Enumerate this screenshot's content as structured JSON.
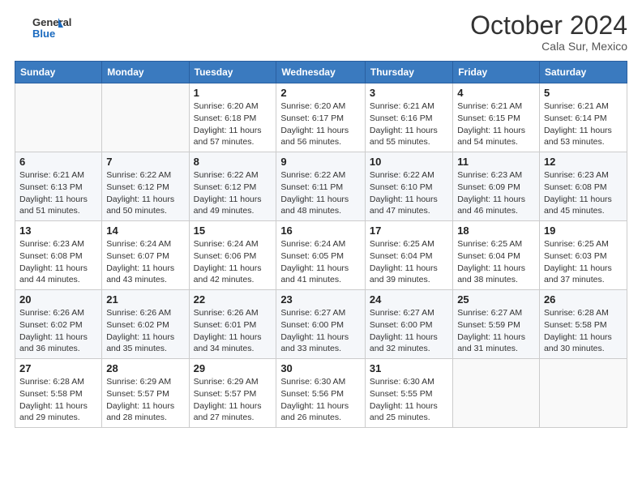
{
  "header": {
    "logo_text_general": "General",
    "logo_text_blue": "Blue",
    "month": "October 2024",
    "location": "Cala Sur, Mexico"
  },
  "weekdays": [
    "Sunday",
    "Monday",
    "Tuesday",
    "Wednesday",
    "Thursday",
    "Friday",
    "Saturday"
  ],
  "weeks": [
    [
      {
        "day": "",
        "sunrise": "",
        "sunset": "",
        "daylight": ""
      },
      {
        "day": "",
        "sunrise": "",
        "sunset": "",
        "daylight": ""
      },
      {
        "day": "1",
        "sunrise": "Sunrise: 6:20 AM",
        "sunset": "Sunset: 6:18 PM",
        "daylight": "Daylight: 11 hours and 57 minutes."
      },
      {
        "day": "2",
        "sunrise": "Sunrise: 6:20 AM",
        "sunset": "Sunset: 6:17 PM",
        "daylight": "Daylight: 11 hours and 56 minutes."
      },
      {
        "day": "3",
        "sunrise": "Sunrise: 6:21 AM",
        "sunset": "Sunset: 6:16 PM",
        "daylight": "Daylight: 11 hours and 55 minutes."
      },
      {
        "day": "4",
        "sunrise": "Sunrise: 6:21 AM",
        "sunset": "Sunset: 6:15 PM",
        "daylight": "Daylight: 11 hours and 54 minutes."
      },
      {
        "day": "5",
        "sunrise": "Sunrise: 6:21 AM",
        "sunset": "Sunset: 6:14 PM",
        "daylight": "Daylight: 11 hours and 53 minutes."
      }
    ],
    [
      {
        "day": "6",
        "sunrise": "Sunrise: 6:21 AM",
        "sunset": "Sunset: 6:13 PM",
        "daylight": "Daylight: 11 hours and 51 minutes."
      },
      {
        "day": "7",
        "sunrise": "Sunrise: 6:22 AM",
        "sunset": "Sunset: 6:12 PM",
        "daylight": "Daylight: 11 hours and 50 minutes."
      },
      {
        "day": "8",
        "sunrise": "Sunrise: 6:22 AM",
        "sunset": "Sunset: 6:12 PM",
        "daylight": "Daylight: 11 hours and 49 minutes."
      },
      {
        "day": "9",
        "sunrise": "Sunrise: 6:22 AM",
        "sunset": "Sunset: 6:11 PM",
        "daylight": "Daylight: 11 hours and 48 minutes."
      },
      {
        "day": "10",
        "sunrise": "Sunrise: 6:22 AM",
        "sunset": "Sunset: 6:10 PM",
        "daylight": "Daylight: 11 hours and 47 minutes."
      },
      {
        "day": "11",
        "sunrise": "Sunrise: 6:23 AM",
        "sunset": "Sunset: 6:09 PM",
        "daylight": "Daylight: 11 hours and 46 minutes."
      },
      {
        "day": "12",
        "sunrise": "Sunrise: 6:23 AM",
        "sunset": "Sunset: 6:08 PM",
        "daylight": "Daylight: 11 hours and 45 minutes."
      }
    ],
    [
      {
        "day": "13",
        "sunrise": "Sunrise: 6:23 AM",
        "sunset": "Sunset: 6:08 PM",
        "daylight": "Daylight: 11 hours and 44 minutes."
      },
      {
        "day": "14",
        "sunrise": "Sunrise: 6:24 AM",
        "sunset": "Sunset: 6:07 PM",
        "daylight": "Daylight: 11 hours and 43 minutes."
      },
      {
        "day": "15",
        "sunrise": "Sunrise: 6:24 AM",
        "sunset": "Sunset: 6:06 PM",
        "daylight": "Daylight: 11 hours and 42 minutes."
      },
      {
        "day": "16",
        "sunrise": "Sunrise: 6:24 AM",
        "sunset": "Sunset: 6:05 PM",
        "daylight": "Daylight: 11 hours and 41 minutes."
      },
      {
        "day": "17",
        "sunrise": "Sunrise: 6:25 AM",
        "sunset": "Sunset: 6:04 PM",
        "daylight": "Daylight: 11 hours and 39 minutes."
      },
      {
        "day": "18",
        "sunrise": "Sunrise: 6:25 AM",
        "sunset": "Sunset: 6:04 PM",
        "daylight": "Daylight: 11 hours and 38 minutes."
      },
      {
        "day": "19",
        "sunrise": "Sunrise: 6:25 AM",
        "sunset": "Sunset: 6:03 PM",
        "daylight": "Daylight: 11 hours and 37 minutes."
      }
    ],
    [
      {
        "day": "20",
        "sunrise": "Sunrise: 6:26 AM",
        "sunset": "Sunset: 6:02 PM",
        "daylight": "Daylight: 11 hours and 36 minutes."
      },
      {
        "day": "21",
        "sunrise": "Sunrise: 6:26 AM",
        "sunset": "Sunset: 6:02 PM",
        "daylight": "Daylight: 11 hours and 35 minutes."
      },
      {
        "day": "22",
        "sunrise": "Sunrise: 6:26 AM",
        "sunset": "Sunset: 6:01 PM",
        "daylight": "Daylight: 11 hours and 34 minutes."
      },
      {
        "day": "23",
        "sunrise": "Sunrise: 6:27 AM",
        "sunset": "Sunset: 6:00 PM",
        "daylight": "Daylight: 11 hours and 33 minutes."
      },
      {
        "day": "24",
        "sunrise": "Sunrise: 6:27 AM",
        "sunset": "Sunset: 6:00 PM",
        "daylight": "Daylight: 11 hours and 32 minutes."
      },
      {
        "day": "25",
        "sunrise": "Sunrise: 6:27 AM",
        "sunset": "Sunset: 5:59 PM",
        "daylight": "Daylight: 11 hours and 31 minutes."
      },
      {
        "day": "26",
        "sunrise": "Sunrise: 6:28 AM",
        "sunset": "Sunset: 5:58 PM",
        "daylight": "Daylight: 11 hours and 30 minutes."
      }
    ],
    [
      {
        "day": "27",
        "sunrise": "Sunrise: 6:28 AM",
        "sunset": "Sunset: 5:58 PM",
        "daylight": "Daylight: 11 hours and 29 minutes."
      },
      {
        "day": "28",
        "sunrise": "Sunrise: 6:29 AM",
        "sunset": "Sunset: 5:57 PM",
        "daylight": "Daylight: 11 hours and 28 minutes."
      },
      {
        "day": "29",
        "sunrise": "Sunrise: 6:29 AM",
        "sunset": "Sunset: 5:57 PM",
        "daylight": "Daylight: 11 hours and 27 minutes."
      },
      {
        "day": "30",
        "sunrise": "Sunrise: 6:30 AM",
        "sunset": "Sunset: 5:56 PM",
        "daylight": "Daylight: 11 hours and 26 minutes."
      },
      {
        "day": "31",
        "sunrise": "Sunrise: 6:30 AM",
        "sunset": "Sunset: 5:55 PM",
        "daylight": "Daylight: 11 hours and 25 minutes."
      },
      {
        "day": "",
        "sunrise": "",
        "sunset": "",
        "daylight": ""
      },
      {
        "day": "",
        "sunrise": "",
        "sunset": "",
        "daylight": ""
      }
    ]
  ]
}
